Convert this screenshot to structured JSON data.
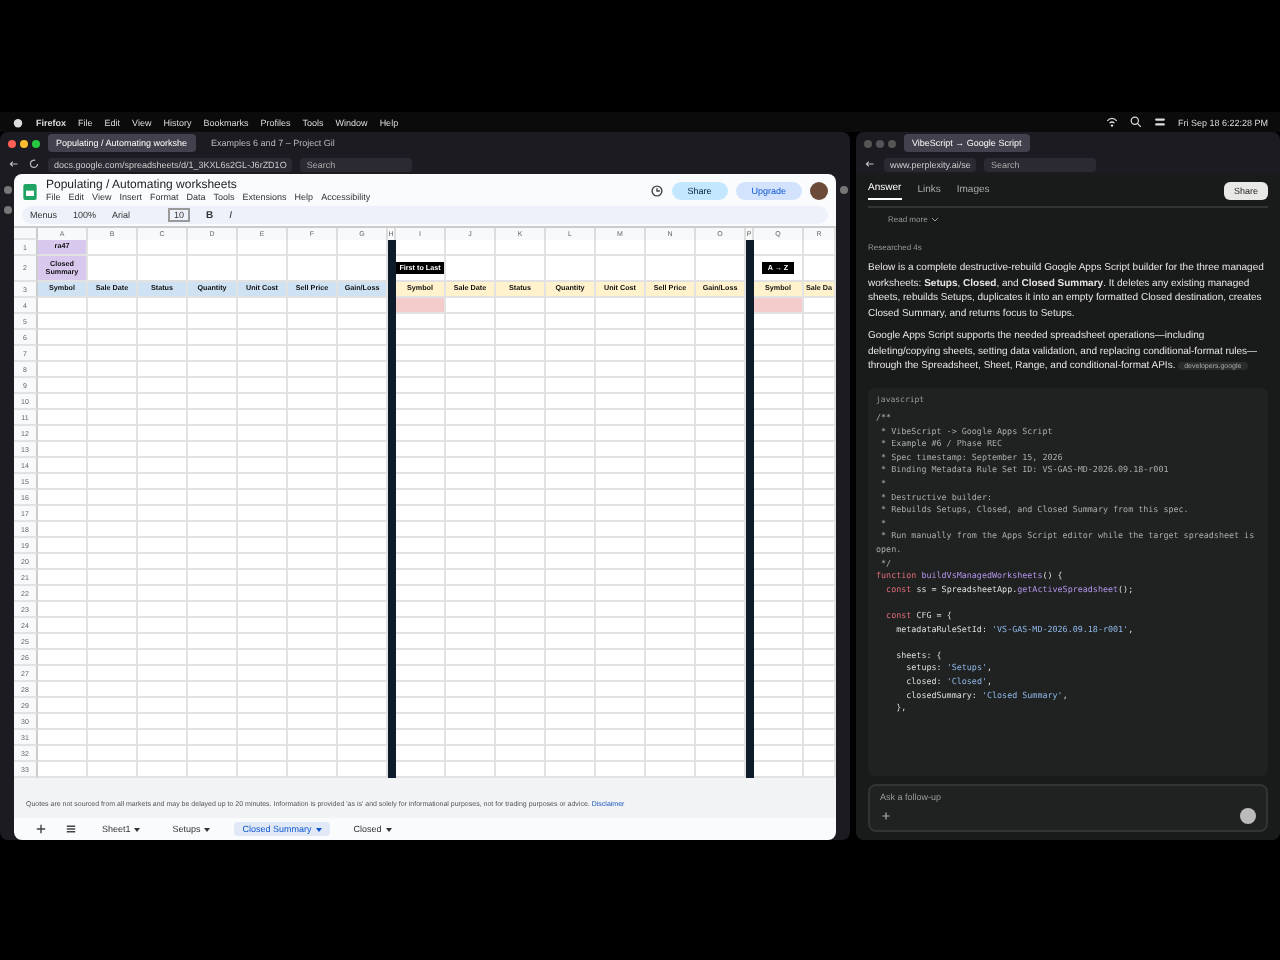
{
  "menubar": {
    "app": "Firefox",
    "items": [
      "File",
      "Edit",
      "View",
      "History",
      "Bookmarks",
      "Profiles",
      "Tools",
      "Window",
      "Help"
    ],
    "clock": "Fri Sep 18 6:22:28 PM"
  },
  "left_browser": {
    "tabs": [
      {
        "label": "Populating / Automating workshe",
        "selected": true
      },
      {
        "label": "Examples 6 and 7 – Project Gil",
        "selected": false
      }
    ],
    "url": "docs.google.com/spreadsheets/d/1_3KXL6s2GL-J6rZD1O",
    "search": {
      "placeholder": "Search"
    }
  },
  "sheet": {
    "title": "Populating / Automating worksheets",
    "menus": [
      "File",
      "Edit",
      "View",
      "Insert",
      "Format",
      "Data",
      "Tools",
      "Extensions",
      "Help",
      "Accessibility"
    ],
    "share": "Share",
    "upgrade": "Upgrade",
    "toolbar": {
      "menus": "Menus",
      "zoom": "100%",
      "font": "Arial",
      "size": "10",
      "bold": "B",
      "italic": "I"
    },
    "columns": [
      {
        "label": "A",
        "kind": "normal"
      },
      {
        "label": "B",
        "kind": "normal"
      },
      {
        "label": "C",
        "kind": "normal"
      },
      {
        "label": "D",
        "kind": "normal"
      },
      {
        "label": "E",
        "kind": "normal"
      },
      {
        "label": "F",
        "kind": "normal"
      },
      {
        "label": "G",
        "kind": "normal"
      },
      {
        "label": "H",
        "kind": "divider"
      },
      {
        "label": "I",
        "kind": "normal"
      },
      {
        "label": "J",
        "kind": "normal"
      },
      {
        "label": "K",
        "kind": "normal"
      },
      {
        "label": "L",
        "kind": "normal"
      },
      {
        "label": "M",
        "kind": "normal"
      },
      {
        "label": "N",
        "kind": "normal"
      },
      {
        "label": "O",
        "kind": "normal"
      },
      {
        "label": "P",
        "kind": "divider"
      },
      {
        "label": "Q",
        "kind": "normal"
      },
      {
        "label": "R",
        "kind": "normal"
      }
    ],
    "rows": [
      {
        "number": "1",
        "cells": [
          {
            "text": "ra47",
            "kind": "summary"
          },
          {
            "kind": "blank"
          },
          {
            "kind": "blank"
          },
          {
            "kind": "blank"
          },
          {
            "kind": "blank"
          },
          {
            "kind": "blank"
          },
          {
            "kind": "blank"
          },
          {
            "kind": "divider"
          },
          {
            "kind": "blank"
          },
          {
            "kind": "blank"
          },
          {
            "kind": "blank"
          },
          {
            "kind": "blank"
          },
          {
            "kind": "blank"
          },
          {
            "kind": "blank"
          },
          {
            "kind": "blank"
          },
          {
            "kind": "divider"
          },
          {
            "kind": "blank"
          },
          {
            "kind": "blank"
          }
        ]
      },
      {
        "number": "2",
        "cells": [
          {
            "text": "Closed Summary",
            "kind": "summary"
          },
          {
            "kind": "blank"
          },
          {
            "kind": "blank"
          },
          {
            "kind": "blank"
          },
          {
            "kind": "blank"
          },
          {
            "kind": "blank"
          },
          {
            "kind": "blank"
          },
          {
            "kind": "divider"
          },
          {
            "text": "First to Last",
            "kind": "label"
          },
          {
            "kind": "blank"
          },
          {
            "kind": "blank"
          },
          {
            "kind": "blank"
          },
          {
            "kind": "blank"
          },
          {
            "kind": "blank"
          },
          {
            "kind": "blank"
          },
          {
            "kind": "divider"
          },
          {
            "text": "A → Z",
            "kind": "label"
          },
          {
            "kind": "blank"
          }
        ]
      },
      {
        "number": "3",
        "cells": [
          {
            "text": "Symbol",
            "kind": "heada"
          },
          {
            "text": "Sale Date",
            "kind": "heada"
          },
          {
            "text": "Status",
            "kind": "heada"
          },
          {
            "text": "Quantity",
            "kind": "heada"
          },
          {
            "text": "Unit Cost",
            "kind": "heada"
          },
          {
            "text": "Sell Price",
            "kind": "heada"
          },
          {
            "text": "Gain/Loss",
            "kind": "heada"
          },
          {
            "kind": "divider"
          },
          {
            "text": "Symbol",
            "kind": "headb"
          },
          {
            "text": "Sale Date",
            "kind": "headb"
          },
          {
            "text": "Status",
            "kind": "headb"
          },
          {
            "text": "Quantity",
            "kind": "headb"
          },
          {
            "text": "Unit Cost",
            "kind": "headb"
          },
          {
            "text": "Sell Price",
            "kind": "headb"
          },
          {
            "text": "Gain/Loss",
            "kind": "headb"
          },
          {
            "kind": "divider"
          },
          {
            "text": "Symbol",
            "kind": "headb"
          },
          {
            "text": "Sale Da",
            "kind": "headb"
          }
        ]
      },
      {
        "number": "4",
        "cells": [
          {
            "kind": "blank"
          },
          {
            "kind": "blank"
          },
          {
            "kind": "blank"
          },
          {
            "kind": "blank"
          },
          {
            "kind": "blank"
          },
          {
            "kind": "blank"
          },
          {
            "kind": "blank"
          },
          {
            "kind": "divider"
          },
          {
            "kind": "pink"
          },
          {
            "kind": "blank"
          },
          {
            "kind": "blank"
          },
          {
            "kind": "blank"
          },
          {
            "kind": "blank"
          },
          {
            "kind": "blank"
          },
          {
            "kind": "blank"
          },
          {
            "kind": "divider"
          },
          {
            "kind": "pink"
          },
          {
            "kind": "blank"
          }
        ]
      }
    ],
    "empty_rows": [
      "5",
      "6",
      "7",
      "8",
      "9",
      "10",
      "11",
      "12",
      "13",
      "14",
      "15",
      "16",
      "17",
      "18",
      "19",
      "20",
      "21",
      "22",
      "23",
      "24",
      "25",
      "26",
      "27",
      "28",
      "29",
      "30",
      "31",
      "32",
      "33"
    ],
    "disclaimer": "Quotes are not sourced from all markets and may be delayed up to 20 minutes. Information is provided 'as is' and solely for informational purposes, not for trading purposes or advice.",
    "disclaimer_link": "Disclaimer",
    "sheet_tabs": [
      {
        "label": "Sheet1",
        "selected": false
      },
      {
        "label": "Setups",
        "selected": false
      },
      {
        "label": "Closed Summary",
        "selected": true
      },
      {
        "label": "Closed",
        "selected": false
      }
    ]
  },
  "right_browser": {
    "tabs": [
      {
        "label": "VibeScript → Google Script",
        "selected": true
      }
    ],
    "url": "www.perplexity.ai/se",
    "search": {
      "placeholder": "Search"
    }
  },
  "answer": {
    "tabs": [
      {
        "label": "Answer",
        "selected": true
      },
      {
        "label": "Links",
        "selected": false
      },
      {
        "label": "Images",
        "selected": false
      }
    ],
    "share": "Share",
    "read_more": "Read more",
    "researched": "Researched 4s",
    "paragraphs": [
      "Below is a complete destructive-rebuild Google Apps Script builder for the three managed worksheets: **Setups**, **Closed**, and **Closed Summary**. It deletes any existing managed sheets, rebuilds Setups, duplicates it into an empty formatted Closed destination, creates Closed Summary, and returns focus to Setups.",
      "Google Apps Script supports the needed spreadsheet operations—including deleting/copying sheets, setting data validation, and replacing conditional-format rules—through the Spreadsheet, Sheet, Range, and conditional-format APIs."
    ],
    "source_chip": "developers.google",
    "code_language": "javascript",
    "code": [
      [
        {
          "kind": "comment",
          "text": "/**"
        }
      ],
      [
        {
          "kind": "comment",
          "text": " * VibeScript -> Google Apps Script"
        }
      ],
      [
        {
          "kind": "comment",
          "text": " * Example #6 / Phase REC"
        }
      ],
      [
        {
          "kind": "comment",
          "text": " * Spec timestamp: September 15, 2026"
        }
      ],
      [
        {
          "kind": "comment",
          "text": " * Binding Metadata Rule Set ID: VS-GAS-MD-2026.09.18-r001"
        }
      ],
      [
        {
          "kind": "comment",
          "text": " *"
        }
      ],
      [
        {
          "kind": "comment",
          "text": " * Destructive builder:"
        }
      ],
      [
        {
          "kind": "comment",
          "text": " * Rebuilds Setups, Closed, and Closed Summary from this spec."
        }
      ],
      [
        {
          "kind": "comment",
          "text": " *"
        }
      ],
      [
        {
          "kind": "comment",
          "text": " * Run manually from the Apps Script editor while the target spreadsheet is open."
        }
      ],
      [
        {
          "kind": "comment",
          "text": " */"
        }
      ],
      [
        {
          "kind": "keyword",
          "text": "function "
        },
        {
          "kind": "name",
          "text": "buildVsManagedWorksheets"
        },
        {
          "kind": "plain",
          "text": "() {"
        }
      ],
      [
        {
          "kind": "keyword",
          "text": "  const "
        },
        {
          "kind": "plain",
          "text": "ss = SpreadsheetApp."
        },
        {
          "kind": "name",
          "text": "getActiveSpreadsheet"
        },
        {
          "kind": "plain",
          "text": "();"
        }
      ],
      [
        {
          "kind": "blank"
        }
      ],
      [
        {
          "kind": "keyword",
          "text": "  const "
        },
        {
          "kind": "plain",
          "text": "CFG = {"
        }
      ],
      [
        {
          "kind": "plain",
          "text": "    metadataRuleSetId: "
        },
        {
          "kind": "string",
          "text": "'VS-GAS-MD-2026.09.18-r001'"
        },
        {
          "kind": "plain",
          "text": ","
        }
      ],
      [
        {
          "kind": "blank"
        }
      ],
      [
        {
          "kind": "plain",
          "text": "    sheets: {"
        }
      ],
      [
        {
          "kind": "plain",
          "text": "      setups: "
        },
        {
          "kind": "string",
          "text": "'Setups'"
        },
        {
          "kind": "plain",
          "text": ","
        }
      ],
      [
        {
          "kind": "plain",
          "text": "      closed: "
        },
        {
          "kind": "string",
          "text": "'Closed'"
        },
        {
          "kind": "plain",
          "text": ","
        }
      ],
      [
        {
          "kind": "plain",
          "text": "      closedSummary: "
        },
        {
          "kind": "string",
          "text": "'Closed Summary'"
        },
        {
          "kind": "plain",
          "text": ","
        }
      ],
      [
        {
          "kind": "plain",
          "text": "    },"
        }
      ]
    ],
    "followup": {
      "placeholder": "Ask a follow-up"
    }
  }
}
